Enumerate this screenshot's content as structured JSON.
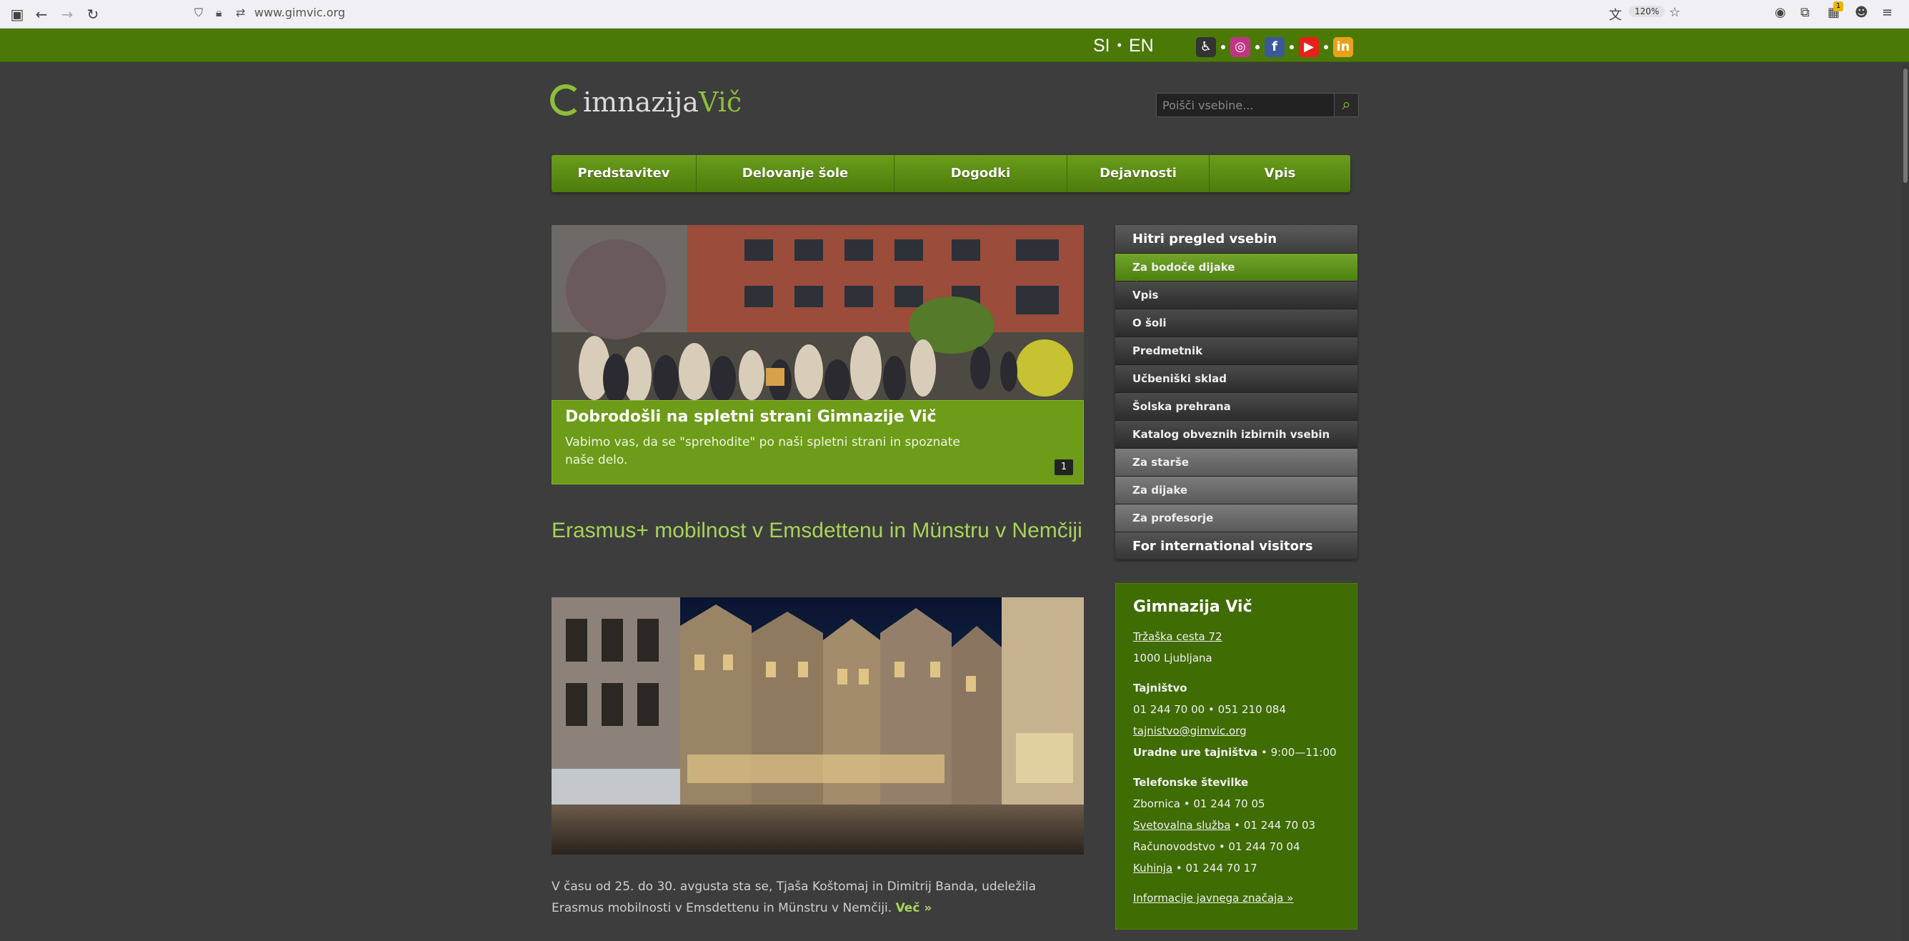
{
  "browser": {
    "url": "www.gimvic.org",
    "zoom": "120%",
    "badge_count": "1"
  },
  "topbar": {
    "lang_si": "SI",
    "lang_sep": "•",
    "lang_en": "EN",
    "social": [
      {
        "name": "accessibility-icon",
        "glyph": "♿",
        "color": "#333333"
      },
      {
        "name": "instagram-icon",
        "glyph": "◎",
        "color": "#c13584"
      },
      {
        "name": "facebook-icon",
        "glyph": "f",
        "color": "#3b5998"
      },
      {
        "name": "youtube-icon",
        "glyph": "▶",
        "color": "#e62117"
      },
      {
        "name": "issuu-icon",
        "glyph": "in",
        "color": "#e8a21a"
      }
    ]
  },
  "header": {
    "logo_main": "imnazija",
    "logo_accent": "Vič",
    "search_placeholder": "Poišči vsebine..."
  },
  "nav": {
    "items": [
      "Predstavitev",
      "Delovanje šole",
      "Dogodki",
      "Dejavnosti",
      "Vpis"
    ]
  },
  "hero": {
    "title": "Dobrodošli na spletni strani Gimnazije Vič",
    "text": "Vabimo vas, da se \"sprehodite\" po naši spletni strani in spoznate naše delo.",
    "pager": "1"
  },
  "article": {
    "title": "Erasmus+ mobilnost v Emsdettenu in Münstru v Nemčiji",
    "text": "V času od 25. do 30. avgusta sta se, Tjaša Koštomaj in Dimitrij Banda, udeležila Erasmus mobilnosti v Emsdettenu in Münstru v Nemčiji.",
    "more": "Več »"
  },
  "quick": {
    "title": "Hitri pregled vsebin",
    "active": "Za bodoče dijake",
    "sub": [
      "Vpis",
      "O šoli",
      "Predmetnik",
      "Učbeniški sklad",
      "Šolska prehrana",
      "Katalog obveznih izbirnih vsebin"
    ],
    "grey": [
      "Za starše",
      "Za dijake",
      "Za profesorje"
    ],
    "footer": "For international visitors"
  },
  "contact": {
    "name": "Gimnazija Vič",
    "address1": "Tržaška cesta 72",
    "address2": "1000 Ljubljana",
    "secretariat_label": "Tajništvo",
    "secretariat_phones": "01 244 70 00 • 051 210 084",
    "email": "tajnistvo@gimvic.org",
    "hours_label": "Uradne ure tajništva",
    "hours_value": " • 9:00—11:00",
    "phones_label": "Telefonske številke",
    "zbornica": "Zbornica • 01 244 70 05",
    "svetovalna_link": "Svetovalna služba",
    "svetovalna_num": " • 01 244 70 03",
    "racunovodstvo": "Računovodstvo • 01 244 70 04",
    "kuhinja_link": "Kuhinja",
    "kuhinja_num": " • 01 244 70 17",
    "info_link": "Informacije javnega značaja »"
  }
}
